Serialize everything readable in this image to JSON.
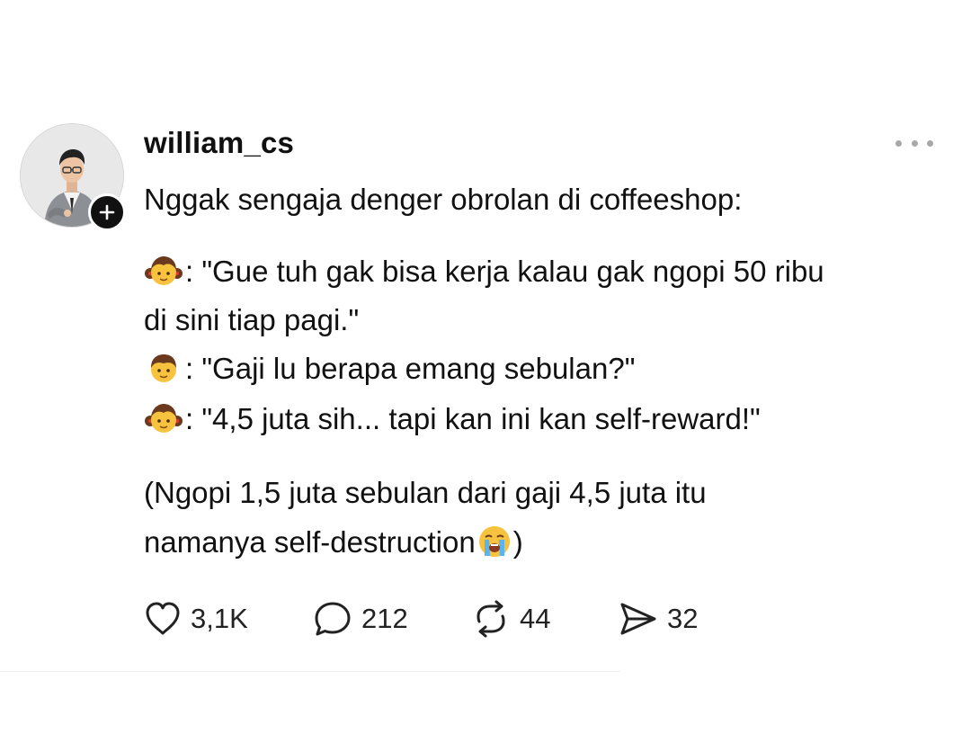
{
  "post": {
    "username": "william_cs",
    "lines": {
      "l1": "Nggak sengaja denger obrolan di coffeeshop:",
      "l2": ": \"Gue tuh gak bisa kerja kalau gak ngopi 50 ribu",
      "l3": "di sini tiap pagi.\"",
      "l4": ": \"Gaji lu berapa emang sebulan?\"",
      "l5": ": \"4,5 juta sih... tapi kan ini kan self-reward!\"",
      "l6": "(Ngopi 1,5 juta sebulan dari gaji 4,5 juta itu",
      "l7a": "namanya self-destruction",
      "l7b": ")"
    },
    "emojis": {
      "speaker_a": "girl-emoji",
      "speaker_b": "boy-emoji",
      "ending": "loudly-crying-face-emoji"
    },
    "actions": {
      "likes": "3,1K",
      "comments": "212",
      "reposts": "44",
      "shares": "32"
    }
  },
  "colors": {
    "text": "#111111",
    "muted": "#a8a8a8",
    "background": "#ffffff"
  }
}
